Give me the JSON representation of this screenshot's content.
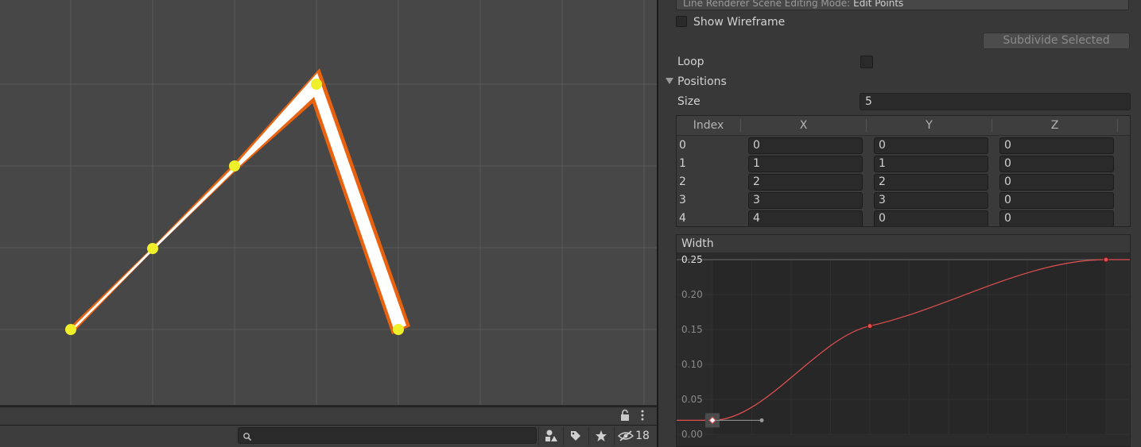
{
  "scene": {
    "search_placeholder": "",
    "hidden_count": "18",
    "icons": [
      "lock-icon",
      "kebab-menu-icon",
      "search-icon",
      "shapes-filter-icon",
      "tag-icon",
      "star-icon",
      "hidden-eye-icon"
    ],
    "line_color": "#ffffff",
    "outline_color": "#e8620f",
    "point_color": "#f0f02a"
  },
  "inspector": {
    "mode_label": "Line Renderer Scene Editing Mode:",
    "mode_value": "Edit Points",
    "show_wireframe_label": "Show Wireframe",
    "subdivide_label": "Subdivide Selected",
    "loop_label": "Loop",
    "positions_label": "Positions",
    "size_label": "Size",
    "size_value": "5",
    "table": {
      "headers": [
        "Index",
        "X",
        "Y",
        "Z"
      ],
      "rows": [
        {
          "index": "0",
          "x": "0",
          "y": "0",
          "z": "0"
        },
        {
          "index": "1",
          "x": "1",
          "y": "1",
          "z": "0"
        },
        {
          "index": "2",
          "x": "2",
          "y": "2",
          "z": "0"
        },
        {
          "index": "3",
          "x": "3",
          "y": "3",
          "z": "0"
        },
        {
          "index": "4",
          "x": "4",
          "y": "0",
          "z": "0"
        }
      ]
    },
    "width_label": "Width",
    "width_curve": {
      "y_ticks": [
        "0.25",
        "0.20",
        "0.15",
        "0.10",
        "0.05",
        "0.00"
      ],
      "keys": [
        {
          "time": 0.0,
          "value": 0.02
        },
        {
          "time": 0.4,
          "value": 0.155
        },
        {
          "time": 1.0,
          "value": 0.25
        }
      ],
      "curve_color": "#e05050"
    }
  }
}
